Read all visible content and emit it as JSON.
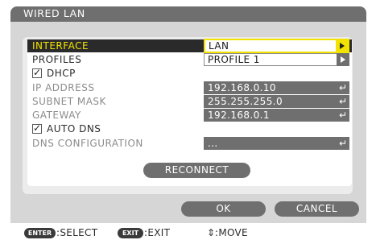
{
  "window": {
    "title": "WIRED LAN"
  },
  "rows": {
    "interface": {
      "label": "INTERFACE",
      "value": "LAN"
    },
    "profiles": {
      "label": "PROFILES",
      "value": "PROFILE 1"
    },
    "dhcp": {
      "label": "DHCP",
      "checked": true,
      "check_glyph": "✓"
    },
    "ip_address": {
      "label": "IP ADDRESS",
      "value": "192.168.0.10"
    },
    "subnet_mask": {
      "label": "SUBNET MASK",
      "value": "255.255.255.0"
    },
    "gateway": {
      "label": "GATEWAY",
      "value": "192.168.0.1"
    },
    "auto_dns": {
      "label": "AUTO DNS",
      "checked": true,
      "check_glyph": "✓"
    },
    "dns_configuration": {
      "label": "DNS CONFIGURATION",
      "value": "..."
    }
  },
  "buttons": {
    "reconnect": "RECONNECT",
    "ok": "OK",
    "cancel": "CANCEL"
  },
  "footer": {
    "enter_key": "ENTER",
    "enter_action": ":SELECT",
    "exit_key": "EXIT",
    "exit_action": ":EXIT",
    "move_glyph": "⇕",
    "move_action": ":MOVE"
  },
  "glyphs": {
    "enter": "↵"
  },
  "colors": {
    "highlight_text": "#f2e300",
    "panel_gray": "#6f6f6f",
    "highlight_bg": "#2a2a2a"
  }
}
